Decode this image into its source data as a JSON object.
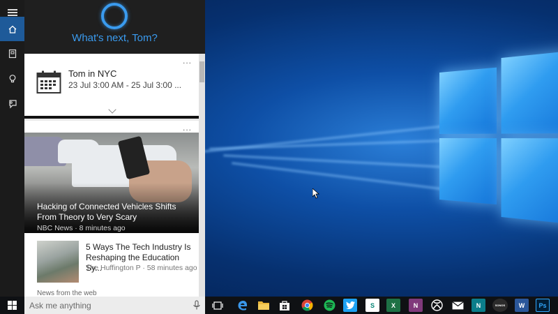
{
  "cortana": {
    "greeting": "What's next, Tom?"
  },
  "trip_card": {
    "title": "Tom in NYC",
    "dates": "23 Jul 3:00 AM - 25 Jul 3:00 ...",
    "more": "..."
  },
  "news_card": {
    "more": "...",
    "top_story": {
      "headline": "Hacking of Connected Vehicles Shifts From Theory to Very Scary",
      "meta": "NBC News · 8 minutes ago"
    },
    "story": {
      "headline": "5 Ways The Tech Industry Is Reshaping the Education Sy...",
      "meta": "The Huffington P · 58 minutes ago"
    },
    "section_label": "News from the web"
  },
  "search": {
    "placeholder": "Ask me anything"
  },
  "taskbar": {
    "apps": [
      {
        "name": "task-view",
        "glyph": "",
        "color": "#0f1114"
      },
      {
        "name": "edge",
        "glyph": "e",
        "color": "#0f1114"
      },
      {
        "name": "file-explorer",
        "glyph": "",
        "color": "#e8b63b"
      },
      {
        "name": "store",
        "glyph": "",
        "color": "#f2f2f2"
      },
      {
        "name": "chrome",
        "glyph": "",
        "color": "#0f1114"
      },
      {
        "name": "spotify",
        "glyph": "",
        "color": "#1db954"
      },
      {
        "name": "twitter",
        "glyph": "",
        "color": "#1da1f2"
      },
      {
        "name": "sway",
        "glyph": "S",
        "color": "#ffffff"
      },
      {
        "name": "excel",
        "glyph": "X",
        "color": "#1e7145"
      },
      {
        "name": "onenote",
        "glyph": "N",
        "color": "#80397b"
      },
      {
        "name": "xbox",
        "glyph": "",
        "color": "#0f1114"
      },
      {
        "name": "mail",
        "glyph": "",
        "color": "#0f1114"
      },
      {
        "name": "news",
        "glyph": "N",
        "color": "#0b7d8a"
      },
      {
        "name": "sonos",
        "glyph": "SONOS",
        "color": "#2b2b2b"
      },
      {
        "name": "word",
        "glyph": "W",
        "color": "#2b579a"
      },
      {
        "name": "photoshop",
        "glyph": "Ps",
        "color": "#001e36"
      }
    ]
  }
}
